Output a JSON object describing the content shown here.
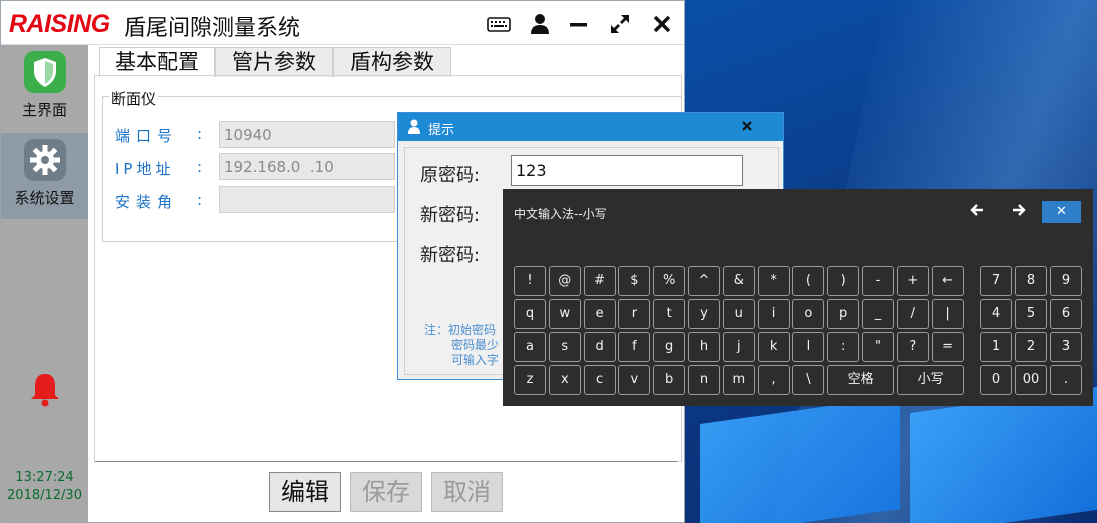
{
  "app": {
    "logo": "RAISING",
    "title": "盾尾间隙测量系统",
    "titlebar_icons": [
      "keyboard-icon",
      "user-icon",
      "minimize-icon",
      "expand-icon",
      "close-icon"
    ]
  },
  "sidebar": {
    "items": [
      {
        "label": "主界面",
        "icon": "shield-icon"
      },
      {
        "label": "系统设置",
        "icon": "gear-icon"
      }
    ],
    "alarm_icon": "bell-icon",
    "time": "13:27:24",
    "date": "2018/12/30"
  },
  "tabs": [
    "基本配置",
    "管片参数",
    "盾构参数"
  ],
  "group": {
    "title": "断面仪",
    "fields": [
      {
        "label": "端口号",
        "value": "10940"
      },
      {
        "label": "IP地址",
        "value": "192.168.0  .10"
      },
      {
        "label": "安装角",
        "value": ""
      }
    ]
  },
  "buttons": {
    "edit": "编辑",
    "save": "保存",
    "cancel": "取消"
  },
  "dialog": {
    "title": "提示",
    "old_password_label": "原密码:",
    "old_password_value": "123",
    "new_password_label": "新密码:",
    "confirm_password_label": "新密码:",
    "notes": [
      "注：初始密码",
      "密码最少",
      "可输入字"
    ]
  },
  "keyboard": {
    "title": "中文输入法--小写",
    "rows": [
      [
        "!",
        "@",
        "#",
        "$",
        "%",
        "^",
        "&",
        "*",
        "(",
        ")",
        "-",
        "+",
        "←"
      ],
      [
        "q",
        "w",
        "e",
        "r",
        "t",
        "y",
        "u",
        "i",
        "o",
        "p",
        "_",
        "/",
        "|"
      ],
      [
        "a",
        "s",
        "d",
        "f",
        "g",
        "h",
        "j",
        "k",
        "l",
        ":",
        "\"",
        "?",
        "="
      ],
      [
        "z",
        "x",
        "c",
        "v",
        "b",
        "n",
        "m",
        ",",
        "\\",
        "空格",
        "小写"
      ]
    ],
    "numpad": [
      [
        "7",
        "8",
        "9"
      ],
      [
        "4",
        "5",
        "6"
      ],
      [
        "1",
        "2",
        "3"
      ],
      [
        "0",
        "00",
        "."
      ]
    ]
  },
  "colors": {
    "accent": "#1e8ad6",
    "label_blue": "#1a73c7",
    "logo_red": "#e30613"
  }
}
